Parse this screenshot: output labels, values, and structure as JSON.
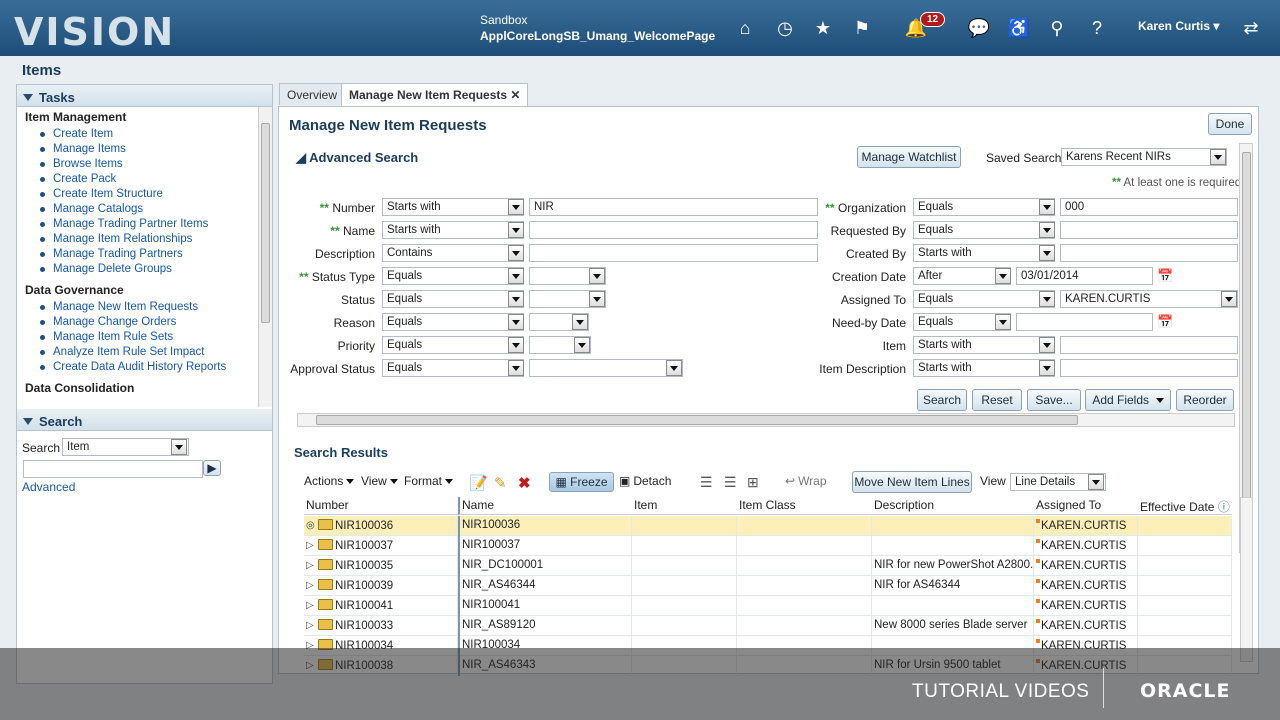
{
  "header": {
    "logo": "VISION",
    "sandbox_label": "Sandbox",
    "sandbox_name": "ApplCoreLongSB_Umang_WelcomePage",
    "notifications_count": "12",
    "user": "Karen Curtis"
  },
  "page_title": "Items",
  "tasks": {
    "title": "Tasks",
    "sections": [
      {
        "heading": "Item Management",
        "items": [
          "Create Item",
          "Manage Items",
          "Browse Items",
          "Create Pack",
          "Create Item Structure",
          "Manage Catalogs",
          "Manage Trading Partner Items",
          "Manage Item Relationships",
          "Manage Trading Partners",
          "Manage Delete Groups"
        ]
      },
      {
        "heading": "Data Governance",
        "items": [
          "Manage New Item Requests",
          "Manage Change Orders",
          "Manage Item Rule Sets",
          "Analyze Item Rule Set Impact",
          "Create Data Audit History Reports"
        ]
      },
      {
        "heading": "Data Consolidation",
        "items": []
      }
    ]
  },
  "search_panel": {
    "title": "Search",
    "label": "Search",
    "value": "Item",
    "advanced": "Advanced"
  },
  "tabs": [
    {
      "label": "Overview"
    },
    {
      "label": "Manage New Item Requests",
      "close": "✕"
    }
  ],
  "main": {
    "title": "Manage New Item Requests",
    "done": "Done",
    "advanced_search": "Advanced Search",
    "manage_watchlist": "Manage Watchlist",
    "saved_search_label": "Saved Search",
    "saved_search_value": "Karens Recent NIRs",
    "required_note": "At least one is required",
    "left_fields": [
      {
        "label": "Number",
        "req": "**",
        "op": "Starts with",
        "value": "NIR"
      },
      {
        "label": "Name",
        "req": "**",
        "op": "Starts with",
        "value": ""
      },
      {
        "label": "Description",
        "req": "",
        "op": "Contains",
        "value": ""
      },
      {
        "label": "Status Type",
        "req": "**",
        "op": "Equals",
        "value": ""
      },
      {
        "label": "Status",
        "req": "",
        "op": "Equals",
        "value": ""
      },
      {
        "label": "Reason",
        "req": "",
        "op": "Equals",
        "value": ""
      },
      {
        "label": "Priority",
        "req": "",
        "op": "Equals",
        "value": ""
      },
      {
        "label": "Approval Status",
        "req": "",
        "op": "Equals",
        "value": ""
      }
    ],
    "right_fields": [
      {
        "label": "Organization",
        "req": "**",
        "op": "Equals",
        "value": "000"
      },
      {
        "label": "Requested By",
        "req": "",
        "op": "Equals",
        "value": ""
      },
      {
        "label": "Created By",
        "req": "",
        "op": "Starts with",
        "value": ""
      },
      {
        "label": "Creation Date",
        "req": "",
        "op": "After",
        "value": "03/01/2014"
      },
      {
        "label": "Assigned To",
        "req": "",
        "op": "Equals",
        "value": "KAREN.CURTIS"
      },
      {
        "label": "Need-by Date",
        "req": "",
        "op": "Equals",
        "value": ""
      },
      {
        "label": "Item",
        "req": "",
        "op": "Starts with",
        "value": ""
      },
      {
        "label": "Item Description",
        "req": "",
        "op": "Starts with",
        "value": ""
      }
    ],
    "buttons": {
      "search": "Search",
      "reset": "Reset",
      "save": "Save...",
      "add_fields": "Add Fields",
      "reorder": "Reorder"
    },
    "results_title": "Search Results",
    "toolbar": {
      "actions": "Actions",
      "view": "View",
      "format": "Format",
      "freeze": "Freeze",
      "detach": "Detach",
      "wrap": "Wrap",
      "move_lines": "Move New Item Lines",
      "view_label": "View",
      "view_value": "Line Details"
    },
    "columns": [
      "Number",
      "Name",
      "Item",
      "Item Class",
      "Description",
      "Assigned To",
      "Effective Date"
    ],
    "rows": [
      {
        "number": "NIR100036",
        "name": "NIR100036",
        "item": "",
        "item_class": "",
        "description": "",
        "assigned": "KAREN.CURTIS"
      },
      {
        "number": "NIR100037",
        "name": "NIR100037",
        "item": "",
        "item_class": "",
        "description": "",
        "assigned": "KAREN.CURTIS"
      },
      {
        "number": "NIR100035",
        "name": "NIR_DC100001",
        "item": "",
        "item_class": "",
        "description": "NIR for new PowerShot A2800...",
        "assigned": "KAREN.CURTIS"
      },
      {
        "number": "NIR100039",
        "name": "NIR_AS46344",
        "item": "",
        "item_class": "",
        "description": "NIR for AS46344",
        "assigned": "KAREN.CURTIS"
      },
      {
        "number": "NIR100041",
        "name": "NIR100041",
        "item": "",
        "item_class": "",
        "description": "",
        "assigned": "KAREN.CURTIS"
      },
      {
        "number": "NIR100033",
        "name": "NIR_AS89120",
        "item": "",
        "item_class": "",
        "description": "New 8000 series Blade server",
        "assigned": "KAREN.CURTIS"
      },
      {
        "number": "NIR100034",
        "name": "NIR100034",
        "item": "",
        "item_class": "",
        "description": "",
        "assigned": "KAREN.CURTIS"
      },
      {
        "number": "NIR100038",
        "name": "NIR_AS46343",
        "item": "",
        "item_class": "",
        "description": "NIR for Ursin 9500 tablet",
        "assigned": "KAREN.CURTIS"
      }
    ]
  },
  "footer": {
    "tutorial": "TUTORIAL VIDEOS",
    "oracle": "ORACLE"
  }
}
